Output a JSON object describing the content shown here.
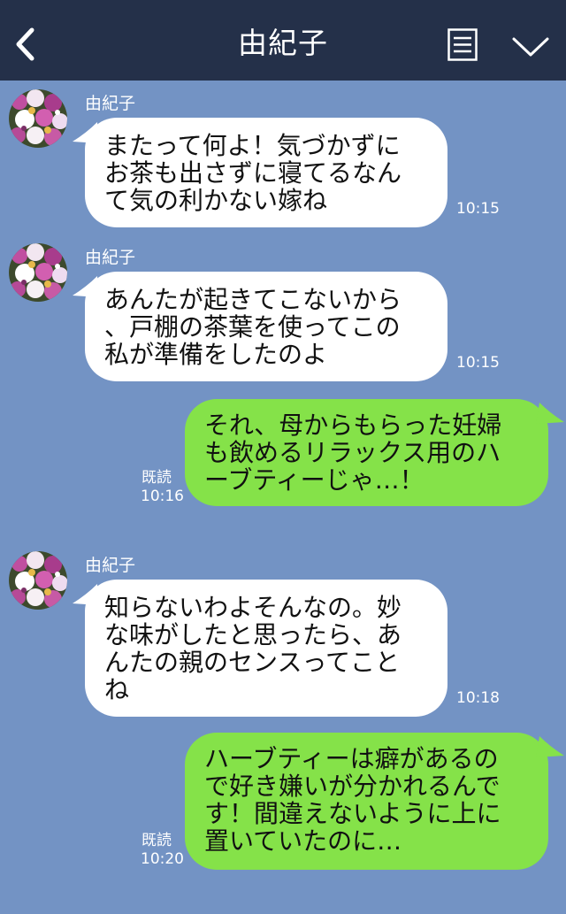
{
  "header": {
    "title": "由紀子"
  },
  "messages": [
    {
      "side": "left",
      "sender": "由紀子",
      "text": "またって何よ！気づかずに\nお茶も出さずに寝てるなん\nて気の利かない嫁ね",
      "time": "10:15"
    },
    {
      "side": "left",
      "sender": "由紀子",
      "text": "あんたが起きてこないから\n、戸棚の茶葉を使ってこの\n私が準備をしたのよ",
      "time": "10:15"
    },
    {
      "side": "right",
      "text": "それ、母からもらった妊婦\nも飲めるリラックス用のハ\nーブティーじゃ…！",
      "read": "既読",
      "time": "10:16"
    },
    {
      "side": "left",
      "sender": "由紀子",
      "text": "知らないわよそんなの。妙\nな味がしたと思ったら、あ\nんたの親のセンスってこと\nね",
      "time": "10:18"
    },
    {
      "side": "right",
      "text": "ハーブティーは癖があるの\nで好き嫌いが分かれるんで\nす！間違えないように上に\n置いていたのに…",
      "read": "既読",
      "time": "10:20"
    }
  ],
  "icons": {
    "back": "chevron-left-icon",
    "menu": "menu-list-icon",
    "expand": "chevron-down-icon",
    "avatar": "orchid-photo"
  },
  "colors": {
    "header_bg": "#243049",
    "chat_bg": "#7393c4",
    "left_bubble": "#ffffff",
    "right_bubble": "#85e249"
  }
}
